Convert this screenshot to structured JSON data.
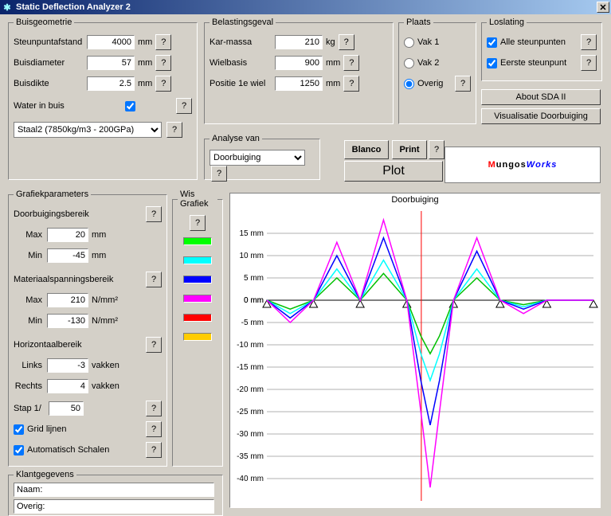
{
  "window": {
    "title": "Static Deflection Analyzer 2"
  },
  "buisgeometrie": {
    "legend": "Buisgeometrie",
    "steunpuntafstand": {
      "label": "Steunpuntafstand",
      "value": "4000",
      "unit": "mm"
    },
    "buisdiameter": {
      "label": "Buisdiameter",
      "value": "57",
      "unit": "mm"
    },
    "buisdikte": {
      "label": "Buisdikte",
      "value": "2.5",
      "unit": "mm"
    },
    "water": {
      "label": "Water in buis",
      "checked": true
    },
    "material": {
      "value": "Staal2 (7850kg/m3 - 200GPa)"
    }
  },
  "belastingsgeval": {
    "legend": "Belastingsgeval",
    "karmassa": {
      "label": "Kar-massa",
      "value": "210",
      "unit": "kg"
    },
    "wielbasis": {
      "label": "Wielbasis",
      "value": "900",
      "unit": "mm"
    },
    "positie": {
      "label": "Positie 1e wiel",
      "value": "1250",
      "unit": "mm"
    }
  },
  "plaats": {
    "legend": "Plaats",
    "vak1": "Vak 1",
    "vak2": "Vak 2",
    "overig": "Overig",
    "selected": "overig"
  },
  "loslating": {
    "legend": "Loslating",
    "alle": {
      "label": "Alle steunpunten",
      "checked": true
    },
    "eerste": {
      "label": "Eerste steunpunt",
      "checked": true
    }
  },
  "buttons": {
    "about": "About SDA II",
    "visualisatie": "Visualisatie Doorbuiging",
    "blanco": "Blanco",
    "print": "Print",
    "plot": "Plot",
    "q": "?"
  },
  "analyse": {
    "legend": "Analyse van",
    "value": "Doorbuiging"
  },
  "grafparam": {
    "legend": "Grafiekparameters",
    "doorb": {
      "label": "Doorbuigingsbereik",
      "max_lbl": "Max",
      "max": "20",
      "min_lbl": "Min",
      "min": "-45",
      "unit": "mm"
    },
    "mat": {
      "label": "Materiaalspanningsbereik",
      "max_lbl": "Max",
      "max": "210",
      "min_lbl": "Min",
      "min": "-130",
      "unit": "N/mm²"
    },
    "horiz": {
      "label": "Horizontaalbereik",
      "links_lbl": "Links",
      "links": "-3",
      "rechts_lbl": "Rechts",
      "rechts": "4",
      "unit": "vakken"
    },
    "stap": {
      "label": "Stap 1/",
      "value": "50"
    },
    "grid": {
      "label": "Grid lijnen",
      "checked": true
    },
    "auto": {
      "label": "Automatisch Schalen",
      "checked": true
    }
  },
  "wis": {
    "legend": "Wis Grafiek",
    "colors": [
      "#00ff00",
      "#00ffff",
      "#0000ff",
      "#ff00ff",
      "#ff0000",
      "#ffcc00"
    ]
  },
  "klant": {
    "legend": "Klantgegevens",
    "naam": "Naam:",
    "overig": "Overig:"
  },
  "branding": {
    "text": "MungosWorks"
  },
  "chart_data": {
    "type": "line",
    "title": "Doorbuiging",
    "ylabel": "mm",
    "ylim": [
      -45,
      20
    ],
    "yticks": [
      15,
      10,
      5,
      0,
      -5,
      -10,
      -15,
      -20,
      -25,
      -30,
      -35,
      -40
    ],
    "xlim": [
      -3,
      4
    ],
    "supports_x": [
      -3,
      -2,
      -1,
      0,
      1,
      2,
      3,
      4
    ],
    "vline_x": 0.31,
    "series": [
      {
        "name": "green",
        "color": "#00c000",
        "values": [
          [
            -3,
            0
          ],
          [
            -2.5,
            -2
          ],
          [
            -2,
            0
          ],
          [
            -1.5,
            5
          ],
          [
            -1,
            0
          ],
          [
            -0.5,
            6
          ],
          [
            0,
            0
          ],
          [
            0.3,
            -8
          ],
          [
            0.5,
            -12
          ],
          [
            0.7,
            -8
          ],
          [
            1,
            0
          ],
          [
            1.5,
            5
          ],
          [
            2,
            0
          ],
          [
            2.5,
            -1
          ],
          [
            3,
            0
          ],
          [
            3.5,
            0
          ],
          [
            4,
            0
          ]
        ]
      },
      {
        "name": "cyan",
        "color": "#00ffff",
        "values": [
          [
            -3,
            0
          ],
          [
            -2.5,
            -3
          ],
          [
            -2,
            0
          ],
          [
            -1.5,
            7
          ],
          [
            -1,
            0
          ],
          [
            -0.5,
            9
          ],
          [
            0,
            0
          ],
          [
            0.3,
            -12
          ],
          [
            0.5,
            -18
          ],
          [
            0.7,
            -12
          ],
          [
            1,
            0
          ],
          [
            1.5,
            7
          ],
          [
            2,
            0
          ],
          [
            2.5,
            -1.5
          ],
          [
            3,
            0
          ],
          [
            3.5,
            0
          ],
          [
            4,
            0
          ]
        ]
      },
      {
        "name": "blue",
        "color": "#0000ff",
        "values": [
          [
            -3,
            0
          ],
          [
            -2.5,
            -4
          ],
          [
            -2,
            0
          ],
          [
            -1.5,
            10
          ],
          [
            -1,
            0
          ],
          [
            -0.5,
            14
          ],
          [
            0,
            0
          ],
          [
            0.3,
            -18
          ],
          [
            0.5,
            -28
          ],
          [
            0.7,
            -18
          ],
          [
            1,
            0
          ],
          [
            1.5,
            11
          ],
          [
            2,
            0
          ],
          [
            2.5,
            -2
          ],
          [
            3,
            0
          ],
          [
            3.5,
            0
          ],
          [
            4,
            0
          ]
        ]
      },
      {
        "name": "magenta",
        "color": "#ff00ff",
        "values": [
          [
            -3,
            0
          ],
          [
            -2.5,
            -5
          ],
          [
            -2,
            0
          ],
          [
            -1.5,
            13
          ],
          [
            -1,
            0
          ],
          [
            -0.5,
            18
          ],
          [
            0,
            0
          ],
          [
            0.3,
            -25
          ],
          [
            0.5,
            -42
          ],
          [
            0.7,
            -25
          ],
          [
            1,
            0
          ],
          [
            1.5,
            14
          ],
          [
            2,
            0
          ],
          [
            2.5,
            -3
          ],
          [
            3,
            0
          ],
          [
            3.5,
            0
          ],
          [
            4,
            0
          ]
        ]
      }
    ]
  }
}
